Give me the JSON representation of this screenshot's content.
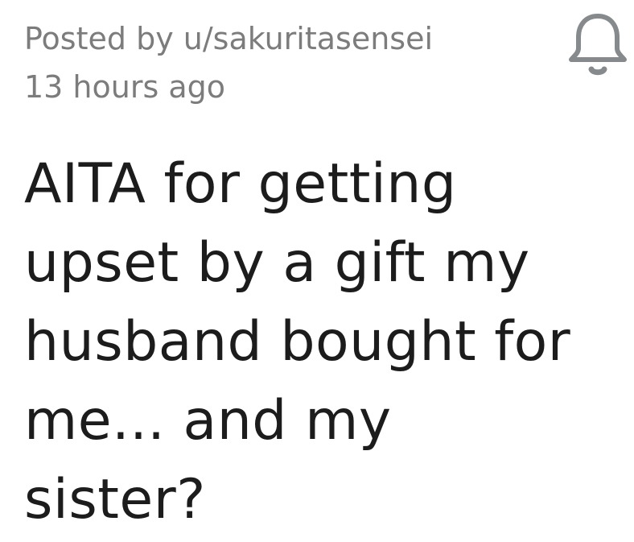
{
  "post": {
    "author_line": "Posted by u/sakuritasensei",
    "timestamp": "13 hours ago",
    "title_lines": [
      "AITA for getting",
      "upset by a gift my",
      "husband bought for",
      "me... and my",
      "sister?"
    ]
  },
  "icons": {
    "notification": "bell-icon"
  },
  "colors": {
    "meta_text": "#7c7c7c",
    "title_text": "#1c1c1c",
    "icon_stroke": "#878a8c"
  }
}
